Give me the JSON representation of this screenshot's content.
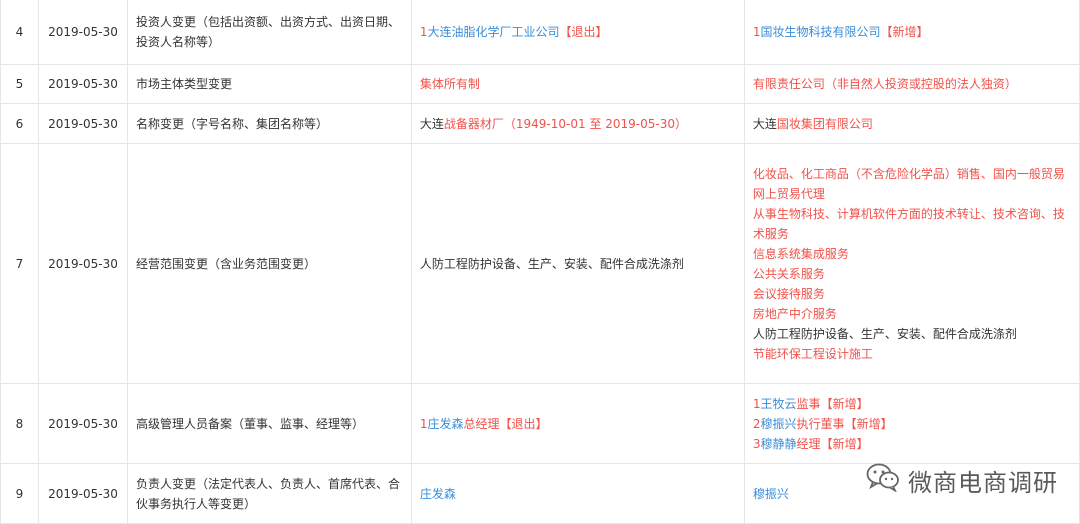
{
  "rows": [
    {
      "no": "4",
      "date": "2019-05-30",
      "item": "投资人变更（包括出资额、出资方式、出资日期、投资人名称等）",
      "before": [
        {
          "prefix": "1",
          "name": "大连油脂化学厂工业公司",
          "tag": "【退出】"
        }
      ],
      "after": [
        {
          "prefix": "1",
          "name": "国妆生物科技有限公司",
          "tag": "【新增】"
        }
      ]
    },
    {
      "no": "5",
      "date": "2019-05-30",
      "item": "市场主体类型变更",
      "before_text": "集体所有制",
      "after_text": "有限责任公司（非自然人投资或控股的法人独资）"
    },
    {
      "no": "6",
      "date": "2019-05-30",
      "item": "名称变更（字号名称、集团名称等）",
      "before_parts": [
        "大连",
        "战备器材厂（1949-10-01 至 2019-05-30）"
      ],
      "after_parts": [
        "大连",
        "国妆集团有限公司"
      ]
    },
    {
      "no": "7",
      "date": "2019-05-30",
      "item": "经营范围变更（含业务范围变更）",
      "before_text": "人防工程防护设备、生产、安装、配件合成洗涤剂",
      "after_lines": [
        {
          "text": "化妆品、化工商品（不含危险化学品）销售、国内一般贸易",
          "color": "red"
        },
        {
          "text": "网上贸易代理",
          "color": "red"
        },
        {
          "text": "从事生物科技、计算机软件方面的技术转让、技术咨询、技术服务",
          "color": "red"
        },
        {
          "text": "信息系统集成服务",
          "color": "red"
        },
        {
          "text": "公共关系服务",
          "color": "red"
        },
        {
          "text": "会议接待服务",
          "color": "red"
        },
        {
          "text": "房地产中介服务",
          "color": "red"
        },
        {
          "text": "人防工程防护设备、生产、安装、配件合成洗涤剂",
          "color": "dark"
        },
        {
          "text": "节能环保工程设计施工",
          "color": "red"
        }
      ]
    },
    {
      "no": "8",
      "date": "2019-05-30",
      "item": "高级管理人员备案（董事、监事、经理等）",
      "before": [
        {
          "prefix": "1",
          "name": "庄发森",
          "role": "总经理",
          "tag": "【退出】"
        }
      ],
      "after": [
        {
          "prefix": "1",
          "name": "王牧云",
          "role": "监事",
          "tag": "【新增】"
        },
        {
          "prefix": "2",
          "name": "穆振兴",
          "role": "执行董事",
          "tag": "【新增】"
        },
        {
          "prefix": "3",
          "name": "穆静静",
          "role": "经理",
          "tag": "【新增】"
        }
      ]
    },
    {
      "no": "9",
      "date": "2019-05-30",
      "item": "负责人变更（法定代表人、负责人、首席代表、合伙事务执行人等变更）",
      "before_text": "庄发森",
      "after_text": "穆振兴"
    }
  ],
  "watermark": {
    "text": "微商电商调研",
    "icon": "wechat-icon"
  },
  "colors": {
    "added_removed": "#f1524a",
    "link": "#3a8ed9",
    "text": "#333333",
    "border": "#e6e6e6"
  }
}
